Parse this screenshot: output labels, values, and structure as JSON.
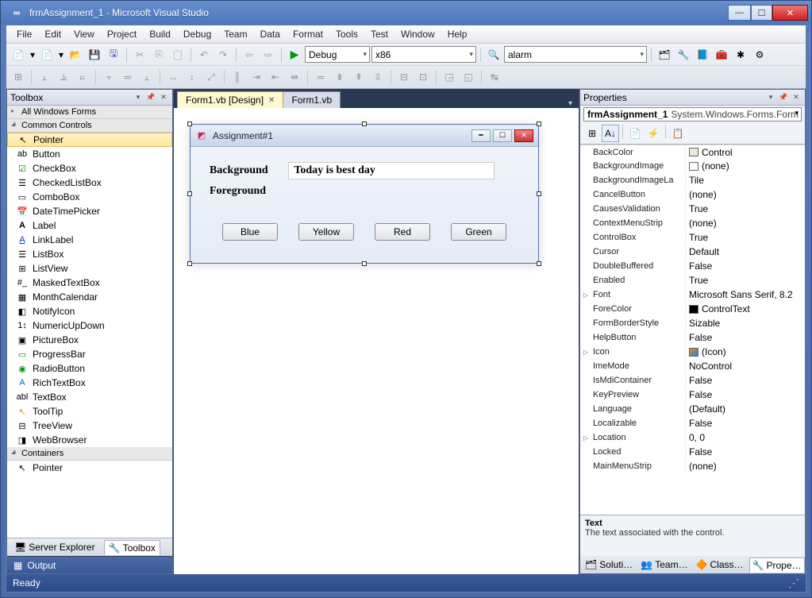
{
  "window": {
    "title": "frmAssignment_1 - Microsoft Visual Studio"
  },
  "menubar": [
    "File",
    "Edit",
    "View",
    "Project",
    "Build",
    "Debug",
    "Team",
    "Data",
    "Format",
    "Tools",
    "Test",
    "Window",
    "Help"
  ],
  "toolbar2": {
    "config": "Debug",
    "platform": "x86",
    "find": "alarm"
  },
  "panels": {
    "toolbox": {
      "title": "Toolbox",
      "groups": {
        "all_forms": "All Windows Forms",
        "common": "Common Controls",
        "containers": "Containers"
      },
      "items": [
        {
          "icon": "↖",
          "label": "Pointer",
          "sel": true
        },
        {
          "icon": "ab",
          "label": "Button"
        },
        {
          "icon": "☑",
          "label": "CheckBox",
          "color": "#090"
        },
        {
          "icon": "☰",
          "label": "CheckedListBox"
        },
        {
          "icon": "▭",
          "label": "ComboBox"
        },
        {
          "icon": "📅",
          "label": "DateTimePicker"
        },
        {
          "icon": "A",
          "label": "Label",
          "bold": true
        },
        {
          "icon": "A",
          "label": "LinkLabel",
          "color": "#03c",
          "underline": true
        },
        {
          "icon": "☰",
          "label": "ListBox"
        },
        {
          "icon": "⊞",
          "label": "ListView"
        },
        {
          "icon": "#_",
          "label": "MaskedTextBox"
        },
        {
          "icon": "▦",
          "label": "MonthCalendar"
        },
        {
          "icon": "◧",
          "label": "NotifyIcon"
        },
        {
          "icon": "1↕",
          "label": "NumericUpDown"
        },
        {
          "icon": "▣",
          "label": "PictureBox"
        },
        {
          "icon": "▭",
          "label": "ProgressBar",
          "color": "#090"
        },
        {
          "icon": "◉",
          "label": "RadioButton",
          "color": "#090"
        },
        {
          "icon": "A",
          "label": "RichTextBox",
          "color": "#06c"
        },
        {
          "icon": "abl",
          "label": "TextBox"
        },
        {
          "icon": "↖",
          "label": "ToolTip",
          "color": "#c90"
        },
        {
          "icon": "⊟",
          "label": "TreeView"
        },
        {
          "icon": "◨",
          "label": "WebBrowser"
        }
      ],
      "containers_items": [
        {
          "icon": "↖",
          "label": "Pointer"
        }
      ],
      "bottom_tabs": {
        "server": "Server Explorer",
        "toolbox": "Toolbox"
      },
      "output": "Output"
    },
    "designer": {
      "tabs": [
        {
          "label": "Form1.vb [Design]",
          "active": true
        },
        {
          "label": "Form1.vb",
          "active": false
        }
      ],
      "form": {
        "title": "Assignment#1",
        "lbl_bg": "Background",
        "lbl_fg": "Foreground",
        "text_value": "Today is best day",
        "buttons": [
          "Blue",
          "Yellow",
          "Red",
          "Green"
        ]
      }
    },
    "properties": {
      "title": "Properties",
      "object_name": "frmAssignment_1",
      "object_type": "System.Windows.Forms.Form",
      "rows": [
        {
          "name": "BackColor",
          "val": "Control",
          "swatch": "#ece9d8"
        },
        {
          "name": "BackgroundImage",
          "val": "(none)",
          "swatch": "#fff"
        },
        {
          "name": "BackgroundImageLa",
          "val": "Tile"
        },
        {
          "name": "CancelButton",
          "val": "(none)"
        },
        {
          "name": "CausesValidation",
          "val": "True"
        },
        {
          "name": "ContextMenuStrip",
          "val": "(none)"
        },
        {
          "name": "ControlBox",
          "val": "True"
        },
        {
          "name": "Cursor",
          "val": "Default"
        },
        {
          "name": "DoubleBuffered",
          "val": "False"
        },
        {
          "name": "Enabled",
          "val": "True"
        },
        {
          "name": "Font",
          "val": "Microsoft Sans Serif, 8.2",
          "arrow": true
        },
        {
          "name": "ForeColor",
          "val": "ControlText",
          "swatch": "#000"
        },
        {
          "name": "FormBorderStyle",
          "val": "Sizable"
        },
        {
          "name": "HelpButton",
          "val": "False"
        },
        {
          "name": "Icon",
          "val": "(Icon)",
          "arrow": true,
          "iconswatch": true
        },
        {
          "name": "ImeMode",
          "val": "NoControl"
        },
        {
          "name": "IsMdiContainer",
          "val": "False"
        },
        {
          "name": "KeyPreview",
          "val": "False"
        },
        {
          "name": "Language",
          "val": "(Default)"
        },
        {
          "name": "Localizable",
          "val": "False"
        },
        {
          "name": "Location",
          "val": "0, 0",
          "arrow": true
        },
        {
          "name": "Locked",
          "val": "False"
        },
        {
          "name": "MainMenuStrip",
          "val": "(none)"
        }
      ],
      "desc_name": "Text",
      "desc_text": "The text associated with the control.",
      "tabs": [
        "Soluti…",
        "Team…",
        "Class…",
        "Prope…"
      ]
    }
  },
  "statusbar": {
    "ready": "Ready"
  }
}
